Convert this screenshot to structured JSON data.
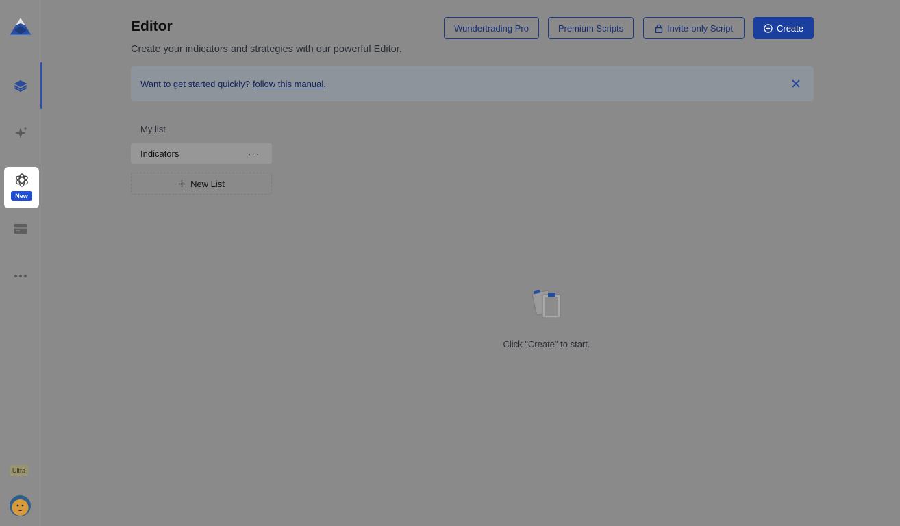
{
  "sidebar": {
    "logo_icon": "mountain-logo-icon",
    "items": [
      {
        "icon": "layers-icon"
      },
      {
        "icon": "sparkles-icon"
      },
      {
        "icon": "openai-icon",
        "badge": "New"
      },
      {
        "icon": "card-icon"
      },
      {
        "icon": "more-dots-icon"
      }
    ],
    "plan_badge": "Ultra",
    "avatar_icon": "avatar"
  },
  "header": {
    "title": "Editor",
    "subtitle": "Create your indicators and strategies with our powerful Editor.",
    "buttons": {
      "wundertrading": "Wundertrading Pro",
      "premium": "Premium Scripts",
      "invite_only": "Invite-only Script",
      "create": "Create"
    }
  },
  "banner": {
    "text": "Want to get started quickly?",
    "link": "follow this manual."
  },
  "lists": {
    "heading": "My list",
    "items": [
      {
        "label": "Indicators",
        "menu": "···"
      }
    ],
    "new_list": "New List"
  },
  "empty_state": {
    "text": "Click \"Create\" to start."
  },
  "colors": {
    "accent": "#1b3f9e",
    "badge_new": "#1f4ed8",
    "overlay_bg": "#8a8a8a"
  }
}
